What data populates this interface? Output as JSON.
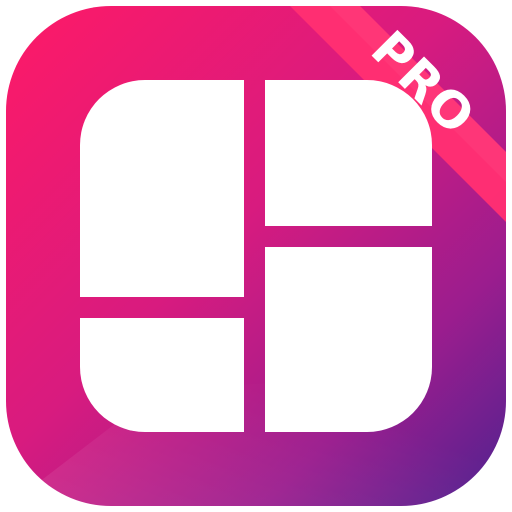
{
  "app_icon": {
    "badge_text": "PRO",
    "icon_name": "photo-collage-grid-icon",
    "colors": {
      "gradient_start": "#ff1a68",
      "gradient_mid": "#c2188f",
      "gradient_end": "#52228f",
      "ribbon": "#ff2f72",
      "tiles": "#ffffff"
    }
  }
}
